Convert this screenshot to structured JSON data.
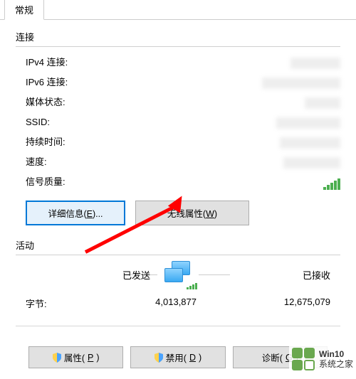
{
  "tab": {
    "general": "常规"
  },
  "connection": {
    "title": "连接",
    "ipv4_label": "IPv4 连接:",
    "ipv6_label": "IPv6 连接:",
    "media_state_label": "媒体状态:",
    "ssid_label": "SSID:",
    "duration_label": "持续时间:",
    "speed_label": "速度:",
    "signal_label": "信号质量:"
  },
  "buttons": {
    "details_pre": "详细信息(",
    "details_key": "E",
    "details_post": ")...",
    "wireless_pre": "无线属性(",
    "wireless_key": "W",
    "wireless_post": ")",
    "properties_pre": "属性(",
    "properties_key": "P",
    "properties_post": ")",
    "disable_pre": "禁用(",
    "disable_key": "D",
    "disable_post": ")",
    "diagnose_pre": "诊断(",
    "diagnose_key": "G",
    "diagnose_post": ")"
  },
  "activity": {
    "title": "活动",
    "sent_label": "已发送",
    "received_label": "已接收",
    "bytes_label": "字节:",
    "bytes_sent": "4,013,877",
    "bytes_received": "12,675,079"
  },
  "watermark": {
    "line1": "Win10",
    "line2": "系统之家"
  }
}
